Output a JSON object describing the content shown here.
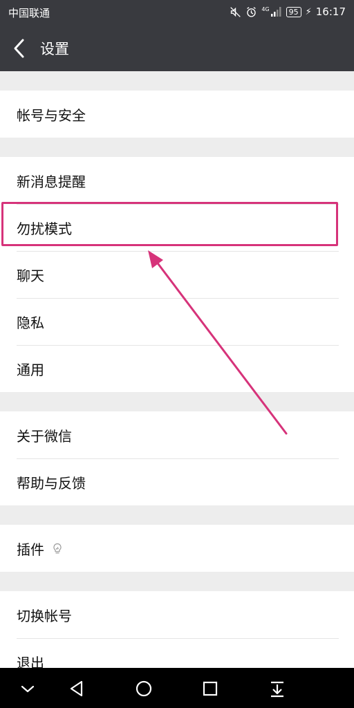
{
  "status_bar": {
    "carrier": "中国联通",
    "network": "4G",
    "battery": "95",
    "time": "16:17"
  },
  "header": {
    "title": "设置"
  },
  "groups": [
    {
      "items": [
        {
          "label": "帐号与安全"
        }
      ]
    },
    {
      "items": [
        {
          "label": "新消息提醒"
        },
        {
          "label": "勿扰模式"
        },
        {
          "label": "聊天"
        },
        {
          "label": "隐私"
        },
        {
          "label": "通用"
        }
      ]
    },
    {
      "items": [
        {
          "label": "关于微信"
        },
        {
          "label": "帮助与反馈"
        }
      ]
    },
    {
      "items": [
        {
          "label": "插件",
          "icon": "lightbulb-icon"
        }
      ]
    },
    {
      "items": [
        {
          "label": "切换帐号"
        },
        {
          "label": "退出"
        }
      ]
    }
  ],
  "annotation": {
    "highlighted_item": "勿扰模式",
    "color": "#d6337a"
  },
  "colors": {
    "bar_bg": "#393a3f",
    "page_bg": "#ededed"
  }
}
